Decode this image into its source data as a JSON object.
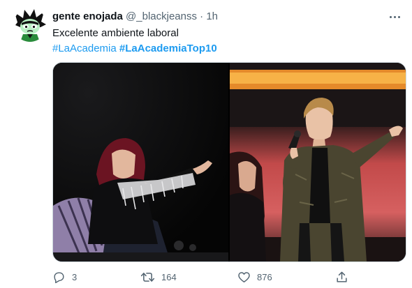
{
  "tweet": {
    "author": {
      "display_name": "gente enojada",
      "handle": "@_blackjeanss",
      "separator": "·",
      "time": "1h"
    },
    "text": "Excelente ambiente laboral",
    "hashtags": [
      "#LaAcademia",
      "#LaAcademiaTop10"
    ],
    "media": {
      "photo_count": 2,
      "photos": [
        {
          "icon": "judge-photo"
        },
        {
          "icon": "performer-photo"
        }
      ]
    },
    "actions": {
      "replies": "3",
      "retweets": "164",
      "likes": "876"
    }
  },
  "colors": {
    "link": "#1d9bf0",
    "muted": "#536471",
    "text": "#0f1419"
  }
}
